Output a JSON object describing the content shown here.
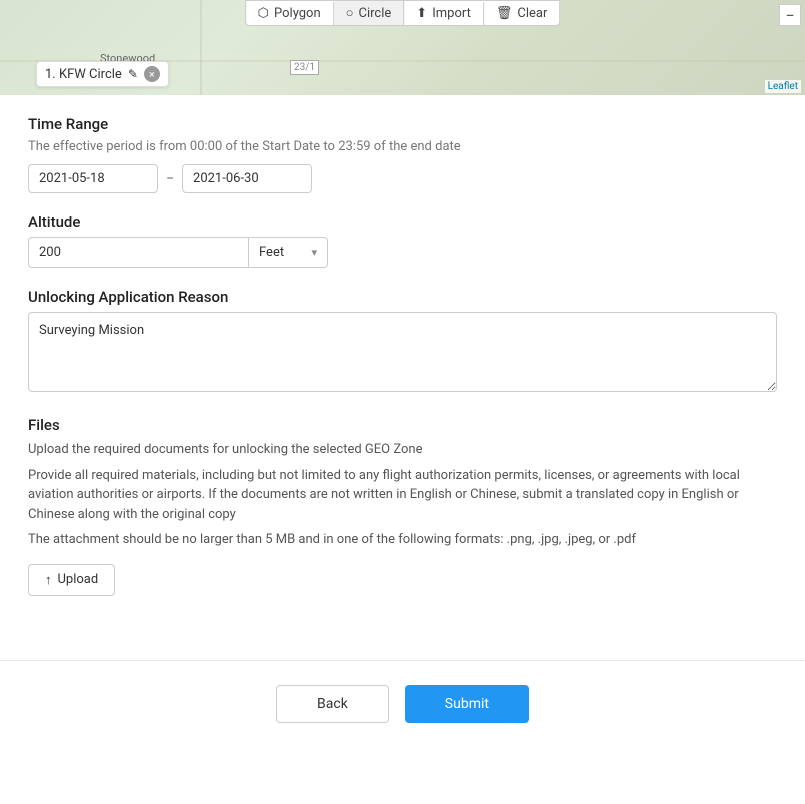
{
  "map": {
    "toolbar": {
      "polygon_label": "Polygon",
      "circle_label": "Circle",
      "import_label": "Import",
      "clear_label": "Clear"
    },
    "leaflet_label": "Leaflet",
    "zoom_out_symbol": "−",
    "stonewood_label": "Stonewood",
    "map_number_label": "23/1",
    "kfw_badge_label": "1. KFW Circle",
    "kfw_edit_symbol": "✎",
    "kfw_close_symbol": "×"
  },
  "time_range": {
    "section_title": "Time Range",
    "description": "The effective period is from 00:00 of the Start Date to 23:59 of the end date",
    "start_date": "2021-05-18",
    "separator": "−",
    "end_date": "2021-06-30"
  },
  "altitude": {
    "section_title": "Altitude",
    "value": "200",
    "unit": "Feet",
    "chevron": "▾"
  },
  "unlocking_reason": {
    "section_title": "Unlocking Application Reason",
    "value": "Surveying Mission"
  },
  "files": {
    "section_title": "Files",
    "description_1": "Upload the required documents for unlocking the selected GEO Zone",
    "description_2": "Provide all required materials, including but not limited to any flight authorization permits, licenses, or agreements with local aviation authorities or airports. If the documents are not written in English or Chinese, submit a translated copy in English or Chinese along with the original copy",
    "description_3": "The attachment should be no larger than 5 MB and in one of the following formats: .png, .jpg, .jpeg, or .pdf",
    "upload_icon": "↑",
    "upload_label": "Upload"
  },
  "footer": {
    "back_label": "Back",
    "submit_label": "Submit"
  }
}
